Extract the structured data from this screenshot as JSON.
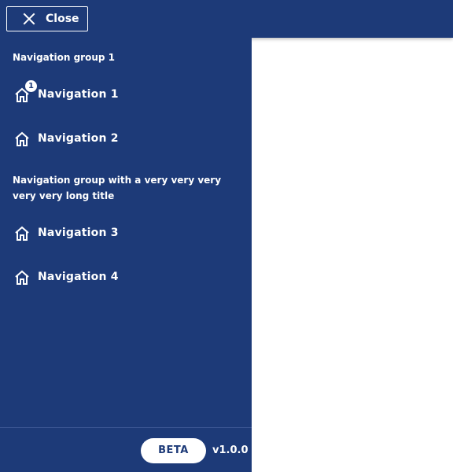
{
  "topbar": {
    "close_label": "Close",
    "close_icon": "close-icon"
  },
  "sidebar": {
    "groups": [
      {
        "title": "Navigation group 1",
        "items": [
          {
            "label": "Navigation 1",
            "icon": "home-icon",
            "badge": "1"
          },
          {
            "label": "Navigation 2",
            "icon": "home-icon"
          }
        ]
      },
      {
        "title": "Navigation group with a very very very very very long title",
        "items": [
          {
            "label": "Navigation 3",
            "icon": "home-icon"
          },
          {
            "label": "Navigation 4",
            "icon": "home-icon"
          }
        ]
      }
    ],
    "footer": {
      "badge_label": "BETA",
      "version": "v1.0.0"
    }
  },
  "colors": {
    "primary": "#1d3a78",
    "on_primary": "#ffffff",
    "background": "#ffffff"
  }
}
